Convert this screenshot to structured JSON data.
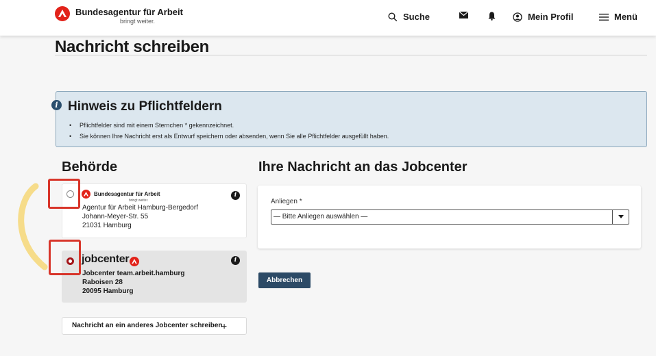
{
  "header": {
    "brand": "Bundesagentur für Arbeit",
    "tagline": "bringt weiter.",
    "nav": {
      "search": "Suche",
      "profile": "Mein Profil",
      "menu": "Menü"
    }
  },
  "page": {
    "title": "Nachricht schreiben"
  },
  "notice": {
    "icon_text": "i",
    "title": "Hinweis zu Pflichtfeldern",
    "items": [
      "Pflichtfelder sind mit einem Sternchen * gekennzeichnet.",
      "Sie können Ihre Nachricht erst als Entwurf speichern oder absenden, wenn Sie alle Pflichtfelder ausgefüllt haben."
    ]
  },
  "authority": {
    "title": "Behörde",
    "cards": [
      {
        "brand": "Bundesagentur für Arbeit",
        "tagline": "bringt weiter.",
        "name": "Agentur für Arbeit Hamburg-Bergedorf",
        "street": "Johann-Meyer-Str. 55",
        "city": "21031 Hamburg",
        "selected": false
      },
      {
        "brand": "jobcenter",
        "name": "Jobcenter team.arbeit.hamburg",
        "street": "Raboisen 28",
        "city": "20095 Hamburg",
        "selected": true
      }
    ],
    "other_button": "Nachricht an ein anderes Jobcenter schreiben",
    "other_button_plus": "+"
  },
  "message": {
    "title": "Ihre Nachricht an das Jobcenter",
    "concern_label": "Anliegen *",
    "concern_value": "— Bitte Anliegen auswählen —",
    "cancel_button": "Abbrechen"
  },
  "colors": {
    "brand_red": "#e2231a",
    "highlight_red": "#d8352a",
    "primary_button": "#2c4a66",
    "notice_bg": "#dce7ef",
    "pen_yellow": "#f6dc8a"
  }
}
